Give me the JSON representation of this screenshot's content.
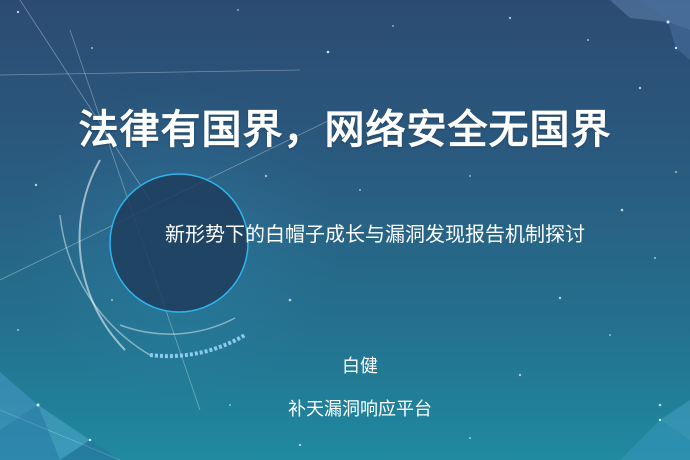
{
  "slide": {
    "title": "法律有国界，网络安全无国界",
    "subtitle": "新形势下的白帽子成长与漏洞发现报告机制探讨",
    "author": "白健",
    "organization": "补天漏洞响应平台"
  },
  "colors": {
    "background_top": "#2c4b73",
    "background_bottom": "#1f8aa0",
    "circle_stroke": "#2fb3ee",
    "circle_fill": "#1e3d5c",
    "text": "#ffffff"
  }
}
